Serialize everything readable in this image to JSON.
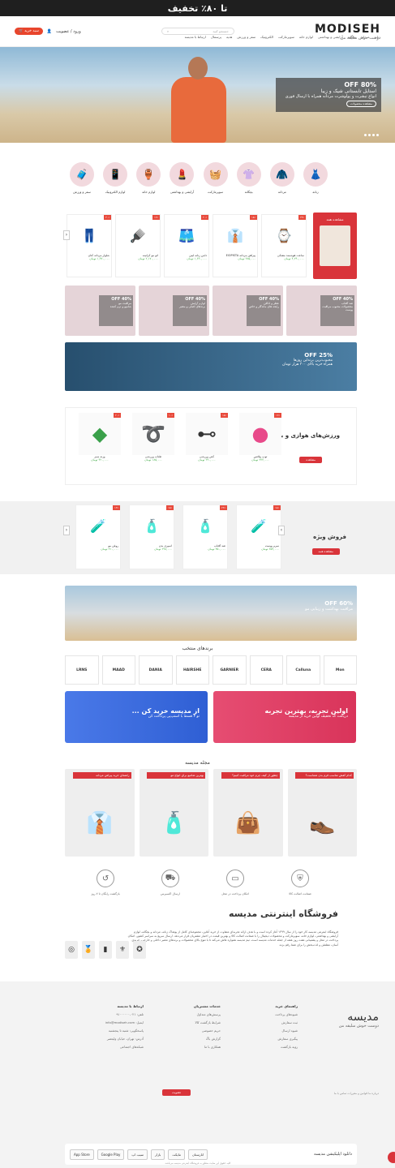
{
  "topbar": {
    "text": "تا ۸۰٪ تخفیف"
  },
  "header": {
    "logo": "MODISEH",
    "tagline": "دوست خوش سلیقه من",
    "search_placeholder": "جستجو کنید",
    "cart_label": "سبد خرید",
    "login_label": "ورود / عضویت"
  },
  "nav": [
    "زنانه",
    "مردانه",
    "بچگانه",
    "آرایشی و بهداشتی",
    "لوازم خانه",
    "سوپرمارکت",
    "الکترونیک",
    "سفر و ورزش",
    "هدیه",
    "پرسمال",
    "ارتباط با مدیسه"
  ],
  "hero": {
    "percent": "80% OFF",
    "title": "استایل تابستانی شیک و زیبا",
    "subtitle": "انواع تیشرت و پولوشرت مردانه همراه با ارسال فوری",
    "button": "مشاهده محصولات"
  },
  "categories": [
    "زنانه",
    "مردانه",
    "بچگانه",
    "سوپرمارکت",
    "آرایشی و بهداشتی",
    "لوازم خانه",
    "لوازم الکترونیک",
    "سفر و ورزش"
  ],
  "deal": {
    "title": "پیشنهاد شگفت انگیز",
    "link": "مشاهده همه",
    "products": [
      {
        "name": "ساعت هوشمند مشکی",
        "price": "۴,۲۹۰,۰۰۰ تومان",
        "badge": "۲۴٪"
      },
      {
        "name": "پیراهن مردانه ElOPISTA",
        "price": "۴۸۵,۰۰۰ تومان",
        "badge": "۱۵٪"
      },
      {
        "name": "دامن زنانه لینن",
        "price": "۱,۶۳۰,۰۰۰ تومان",
        "badge": "۲۰٪"
      },
      {
        "name": "اتو مو کراتینه",
        "price": "۲,۱۷۰,۰۰۰ تومان",
        "badge": "۱۲٪"
      },
      {
        "name": "شلوار مردانه کتان",
        "price": "۱,۳۷۰,۰۰۰ تومان",
        "badge": "۳۰٪"
      }
    ]
  },
  "promos": [
    {
      "pct": "40% OFF",
      "title": "ضد آفتاب",
      "desc": "محصولات محبوب مراقبت پوست"
    },
    {
      "pct": "40% OFF",
      "title": "عطر و ادکلن",
      "desc": "رایحه های ماندگار و خاص"
    },
    {
      "pct": "40% OFF",
      "title": "لوازم آرایش",
      "desc": "برندهای اصلی و معتبر"
    },
    {
      "pct": "40% OFF",
      "title": "مراقبت مو",
      "desc": "شامپو و نرم کننده"
    }
  ],
  "banner2": {
    "pct": "25% OFF",
    "title": "محبوب‌ترین برند‌این روزها",
    "desc": "همراه خرید بالای ۳۰۰ هزار تومان"
  },
  "sport": {
    "title": "ورزش‌های هوازی و بدنسازی",
    "button": "مشاهده",
    "products": [
      {
        "name": "توپ پیلاتس",
        "price": "۳۲۴,۰۰۰ تومان",
        "badge": "۱۲٪",
        "icon": "●"
      },
      {
        "name": "کش ورزشی",
        "price": "۲۹۰,۰۰۰ تومان",
        "badge": "۱۵٪",
        "icon": "⊶"
      },
      {
        "name": "طناب ورزشی",
        "price": "۱۸۵,۰۰۰ تومان",
        "badge": "۱۰٪",
        "icon": "➰"
      },
      {
        "name": "وزنه سبز",
        "price": "۴۲۰,۰۰۰ تومان",
        "badge": "۲۰٪",
        "icon": "◆"
      }
    ]
  },
  "special": {
    "title": "فروش ویژه",
    "button": "مشاهده همه",
    "products": [
      {
        "name": "سرم پوست",
        "price": "۶۵۴,۰۰۰ تومان",
        "badge": "۱۸٪"
      },
      {
        "name": "ضد آفتاب",
        "price": "۳۵۰,۰۰۰ تومان",
        "badge": "۲۲٪"
      },
      {
        "name": "اسپری بدن",
        "price": "۲۹۸,۰۰۰ تومان",
        "badge": "۱۵٪"
      },
      {
        "name": "روغن مو",
        "price": "۴۱۰,۰۰۰ تومان",
        "badge": "۱۳٪"
      }
    ]
  },
  "beach": {
    "pct": "60% OFF",
    "title": "مراقبت بهداشت و زیبایی مو"
  },
  "brands_title": "برندهای منتخب",
  "brands": [
    "Mon",
    "Calluna",
    "CERA",
    "GARNIER",
    "HAIRSHE",
    "DANIA",
    "MAAD",
    "LRNS"
  ],
  "banner_red": {
    "title": "اولین تجربه، بهترین تجربه",
    "desc": "دریافت کد تخفیف اولین خرید از مدیسه"
  },
  "banner_blue": {
    "title": "از مدیسه خرید کن ...",
    "desc": "تو ۴ قسط با اسنپ‌پی پرداخت کن"
  },
  "mag_title": "مجله مدیسه",
  "mags": [
    {
      "title": "کدام کفش مناسب فرم بدن شماست؟",
      "icon": "👞"
    },
    {
      "title": "چطور از کیف چرم خود مراقبت کنیم؟",
      "icon": "👜"
    },
    {
      "title": "بهترین شامپو برای انواع مو",
      "icon": "🧴"
    },
    {
      "title": "راهنمای خرید پیراهن مردانه",
      "icon": "👔"
    }
  ],
  "features": [
    "ضمانت اصالت کالا",
    "امکان پرداخت در محل",
    "ارسال اکسپرس",
    "بازگشت رایگان تا ۷ روز"
  ],
  "about": {
    "title": "فروشگاه اینترنتی مدیسه",
    "text": "فروشگاه اینترنتی مدیسه کار خود را از سال ۱۳۹۹ آغاز کرده است و با هدف ارائه تجربه‌ای متفاوت از خرید آنلاین، مجموعه‌ای کامل از پوشاک زنانه، مردانه و بچگانه، لوازم آرایشی و بهداشتی، لوازم خانه، سوپرمارکت و محصولات دیجیتال را با ضمانت اصالت کالا و بهترین قیمت در اختیار مشتریان قرار می‌دهد. ارسال سریع به سراسر کشور، امکان پرداخت در محل و پشتیبانی هفت روز هفته از جمله خدمات مدیسه است. تیم مدیسه همواره تلاش می‌کند تا با تنوع بالای محصولات و برندهای معتبر داخلی و خارجی، خریدی آسان، مطمئن و لذت‌بخش را برای شما رقم بزند."
  },
  "footer": {
    "logo": "مدیسه",
    "tagline": "دوست خوش سلیقه من",
    "col1_title": "راهنمای خرید",
    "col1": [
      "شیوه‌های پرداخت",
      "ثبت سفارش",
      "شیوه ارسال",
      "پیگیری سفارش",
      "رویه بازگشت"
    ],
    "col2_title": "خدمات مشتریان",
    "col2": [
      "پرسش‌های متداول",
      "شرایط بازگشت کالا",
      "حریم خصوصی",
      "گزارش باگ",
      "همکاری با ما"
    ],
    "col3_title": "ارتباط با مدیسه",
    "col3": [
      "تلفن: ۰۲۱-۹۱۰۰۰۰۰۰",
      "ایمیل: info@modiseh.com",
      "پاسخگویی: شنبه تا پنجشنبه",
      "آدرس: تهران، خیابان ولیعصر",
      "شبکه‌های اجتماعی"
    ],
    "newsletter_btn": "عضویت",
    "links": "درباره ما   قوانین و مقررات   تماس با ما",
    "app_label": "دانلود اپلیکیشن مدیسه",
    "stores": [
      "App Store",
      "Google Play",
      "سیب اپ",
      "بازار",
      "مایکت",
      "انارستان"
    ],
    "copyright": "کلیه حقوق این سایت متعلق به فروشگاه اینترنتی مدیسه می‌باشد."
  }
}
